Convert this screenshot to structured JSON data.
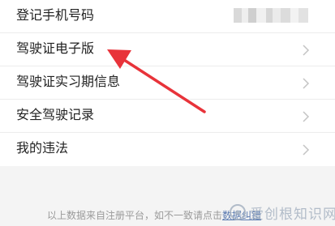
{
  "rows": [
    {
      "label": "登记手机号码",
      "value_masked": true
    },
    {
      "label": "驾驶证电子版"
    },
    {
      "label": "驾驶证实习期信息"
    },
    {
      "label": "安全驾驶记录"
    },
    {
      "label": "我的违法"
    }
  ],
  "footer": {
    "text": "以上数据来自注册平台，如不一致请点击",
    "link": "数据纠错"
  },
  "watermark": {
    "text": "爱创根知识网"
  },
  "colors": {
    "panel_bg": "#ffffff",
    "page_bg": "#f4f4f4",
    "arrow": "#e8333a",
    "label_text": "#222222",
    "footer_text": "#9a9a9a"
  },
  "icons": {
    "row_chevron": "chevron-right-icon",
    "annotation": "red-arrow-icon"
  }
}
